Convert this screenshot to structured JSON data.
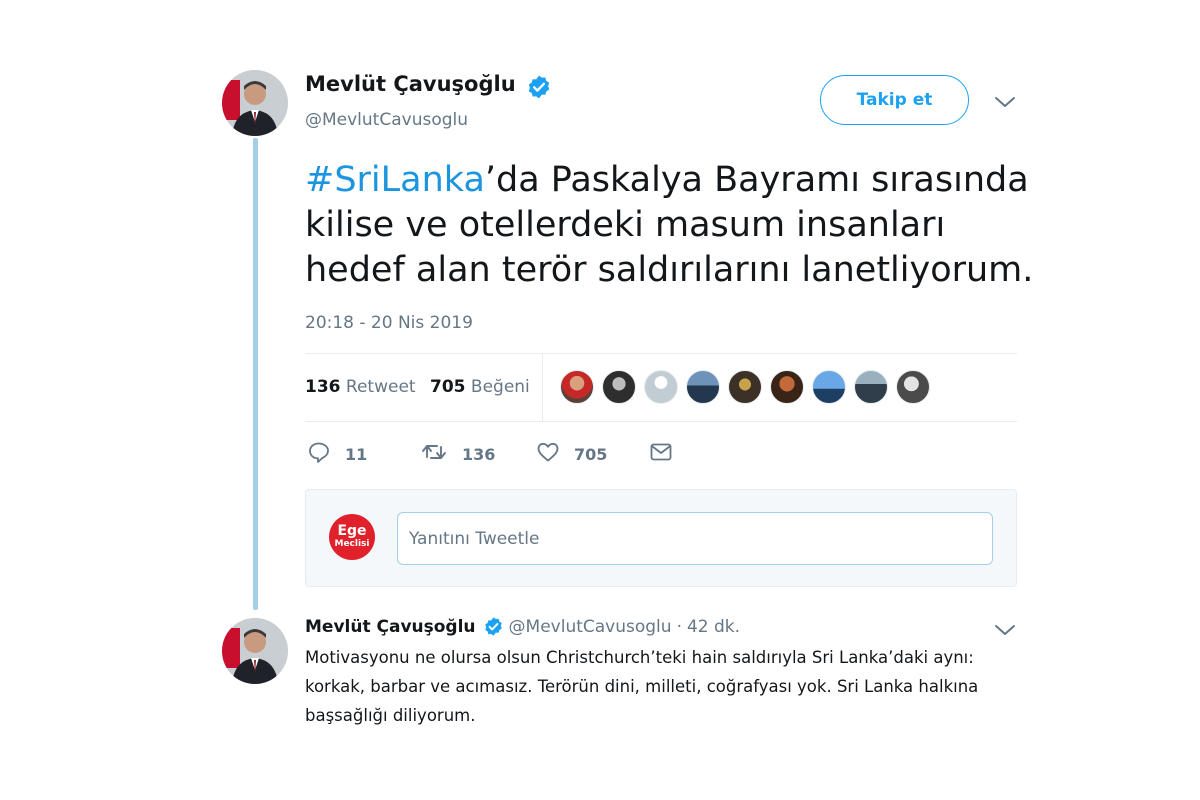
{
  "tweet": {
    "author": {
      "name": "Mevlüt Çavuşoğlu",
      "handle": "@MevlutCavusoglu",
      "verified": true
    },
    "follow_label": "Takip et",
    "text": {
      "hashtag": "#SriLanka",
      "body": "’da Paskalya Bayramı sırasında kilise ve otellerdeki masum insanları hedef alan terör saldırılarını lanetliyorum."
    },
    "timestamp": "20:18 - 20 Nis 2019",
    "stats": {
      "retweets_count": "136",
      "retweets_label": "Retweet",
      "likes_count": "705",
      "likes_label": "Beğeni"
    },
    "liker_avatar_count": 9,
    "actions": {
      "reply_count": "11",
      "retweet_count": "136",
      "like_count": "705"
    }
  },
  "reply_composer": {
    "placeholder": "Yanıtını Tweetle",
    "user_avatar_line1": "Ege",
    "user_avatar_line2": "Meclisi"
  },
  "reply": {
    "name": "Mevlüt Çavuşoğlu",
    "handle": "@MevlutCavusoglu",
    "separator": "·",
    "time": "42 dk.",
    "text": "Motivasyonu ne olursa olsun Christchurch’teki hain saldırıyla Sri Lanka’daki aynı: korkak, barbar ve acımasız. Terörün dini, milleti, coğrafyası yok. Sri Lanka halkına başsağlığı diliyorum."
  },
  "colors": {
    "brand_blue": "#1da1f2",
    "hashtag_blue": "#1b95e0",
    "thread_line": "#a3cfe9",
    "secondary_text": "#657786"
  },
  "icons": [
    "verified-badge-icon",
    "chevron-down-icon",
    "reply-icon",
    "retweet-icon",
    "like-heart-icon",
    "direct-message-icon"
  ]
}
